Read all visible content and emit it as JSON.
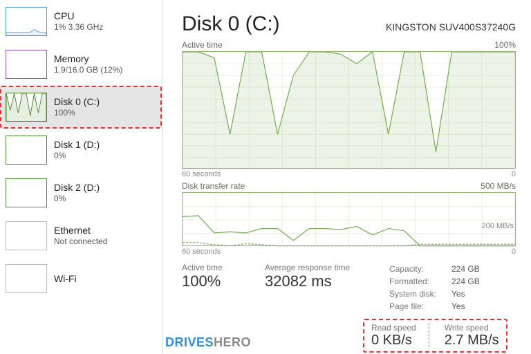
{
  "sidebar": [
    {
      "name": "CPU",
      "sub": "1% 3.36 GHz",
      "color": "#4aa3df",
      "spark": [
        10,
        11,
        10,
        10,
        11,
        10,
        12,
        22,
        14,
        10,
        10
      ]
    },
    {
      "name": "Memory",
      "sub": "1.9/16.0 GB (12%)",
      "color": "#9a4fbf",
      "spark": []
    },
    {
      "name": "Disk 0 (C:)",
      "sub": "100%",
      "color": "#4a8a2a",
      "spark": [
        100,
        40,
        100,
        30,
        100,
        100,
        20,
        100,
        30,
        100,
        100
      ],
      "selected": true,
      "highlight": true
    },
    {
      "name": "Disk 1 (D:)",
      "sub": "0%",
      "color": "#4a8a2a",
      "spark": []
    },
    {
      "name": "Disk 2 (D:)",
      "sub": "0%",
      "color": "#4a8a2a",
      "spark": []
    },
    {
      "name": "Ethernet",
      "sub": "Not connected",
      "color": "#bbbbbb",
      "spark": []
    },
    {
      "name": "Wi-Fi",
      "sub": "",
      "color": "#bbbbbb",
      "spark": []
    }
  ],
  "header": {
    "title": "Disk 0 (C:)",
    "model": "KINGSTON SUV400S37240G"
  },
  "chart_data": [
    {
      "type": "area",
      "title": "Active time",
      "x_left": "60 seconds",
      "x_right": "0",
      "ylim": [
        0,
        100
      ],
      "ylabel_right": "100%",
      "series": [
        {
          "name": "Active time %",
          "values": [
            100,
            100,
            95,
            30,
            100,
            100,
            30,
            80,
            100,
            100,
            98,
            90,
            100,
            30,
            100,
            100,
            15,
            100,
            100,
            100,
            100,
            100
          ]
        }
      ],
      "color": "#6fae4a"
    },
    {
      "type": "line",
      "title": "Disk transfer rate",
      "x_left": "60 seconds",
      "x_right": "0",
      "ylim": [
        0,
        500
      ],
      "ylabel_right": "500 MB/s",
      "annotations": [
        "200 MB/s"
      ],
      "series": [
        {
          "name": "Read",
          "values": [
            280,
            290,
            130,
            140,
            130,
            170,
            170,
            60,
            170,
            170,
            160,
            190,
            110,
            170,
            150,
            10,
            10,
            10,
            10,
            10,
            10,
            10
          ]
        },
        {
          "name": "Write",
          "values": [
            40,
            40,
            20,
            10,
            30,
            20,
            10,
            10,
            10,
            10,
            10,
            10,
            10,
            10,
            10,
            25,
            25,
            25,
            25,
            25,
            25,
            25
          ]
        }
      ],
      "color": "#6fae4a"
    }
  ],
  "stats": {
    "active_time": {
      "label": "Active time",
      "value": "100%"
    },
    "avg_response": {
      "label": "Average response time",
      "value": "32082 ms"
    },
    "read": {
      "label": "Read speed",
      "value": "0 KB/s"
    },
    "write": {
      "label": "Write speed",
      "value": "2.7 MB/s"
    },
    "capacity": {
      "label": "Capacity:",
      "value": "224 GB"
    },
    "formatted": {
      "label": "Formatted:",
      "value": "224 GB"
    },
    "system_disk": {
      "label": "System disk:",
      "value": "Yes"
    },
    "page_file": {
      "label": "Page file:",
      "value": "Yes"
    }
  },
  "watermark": {
    "a": "DRIVES",
    "b": "HERO"
  }
}
